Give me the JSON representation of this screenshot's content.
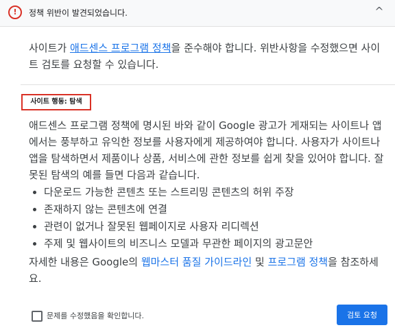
{
  "header": {
    "title": "정책 위반이 발견되었습니다.",
    "warning_icon": "!",
    "collapse_icon": "^"
  },
  "intro": {
    "prefix": "사이트가 ",
    "policy_link": "애드센스 프로그램 정책",
    "suffix": "을 준수해야 합니다. 위반사항을 수정했으면 사이트 검토를 요청할 수 있습니다."
  },
  "violation": {
    "tag": "사이트 행동: 탐색",
    "description": "애드센스 프로그램 정책에 명시된 바와 같이 Google 광고가 게재되는 사이트나 앱에서는 풍부하고 유익한 정보를 사용자에게 제공하여야 합니다. 사용자가 사이트나 앱을 탐색하면서 제품이나 상품, 서비스에 관한 정보를 쉽게 찾을 있어야 합니다. 잘못된 탐색의 예를 들면 다음과 같습니다.",
    "examples": [
      "다운로드 가능한 콘텐츠 또는 스트리밍 콘텐츠의 허위 주장",
      "존재하지 않는 콘텐츠에 연결",
      "관련이 없거나 잘못된 웹페이지로 사용자 리디렉션",
      "주제 및 웹사이트의 비즈니스 모델과 무관한 페이지의 광고문안"
    ]
  },
  "closing": {
    "prefix": "자세한 내용은 Google의 ",
    "guidelines_link": "웹마스터 품질 가이드라인",
    "middle": " 및 ",
    "program_policy_link": "프로그램 정책",
    "suffix": "을 참조하세요."
  },
  "footer": {
    "checkbox_label": "문제를 수정했음을 확인합니다.",
    "checkbox_checked": false,
    "submit_label": "검토 요청"
  },
  "colors": {
    "accent": "#1a73e8",
    "error": "#d93025"
  }
}
